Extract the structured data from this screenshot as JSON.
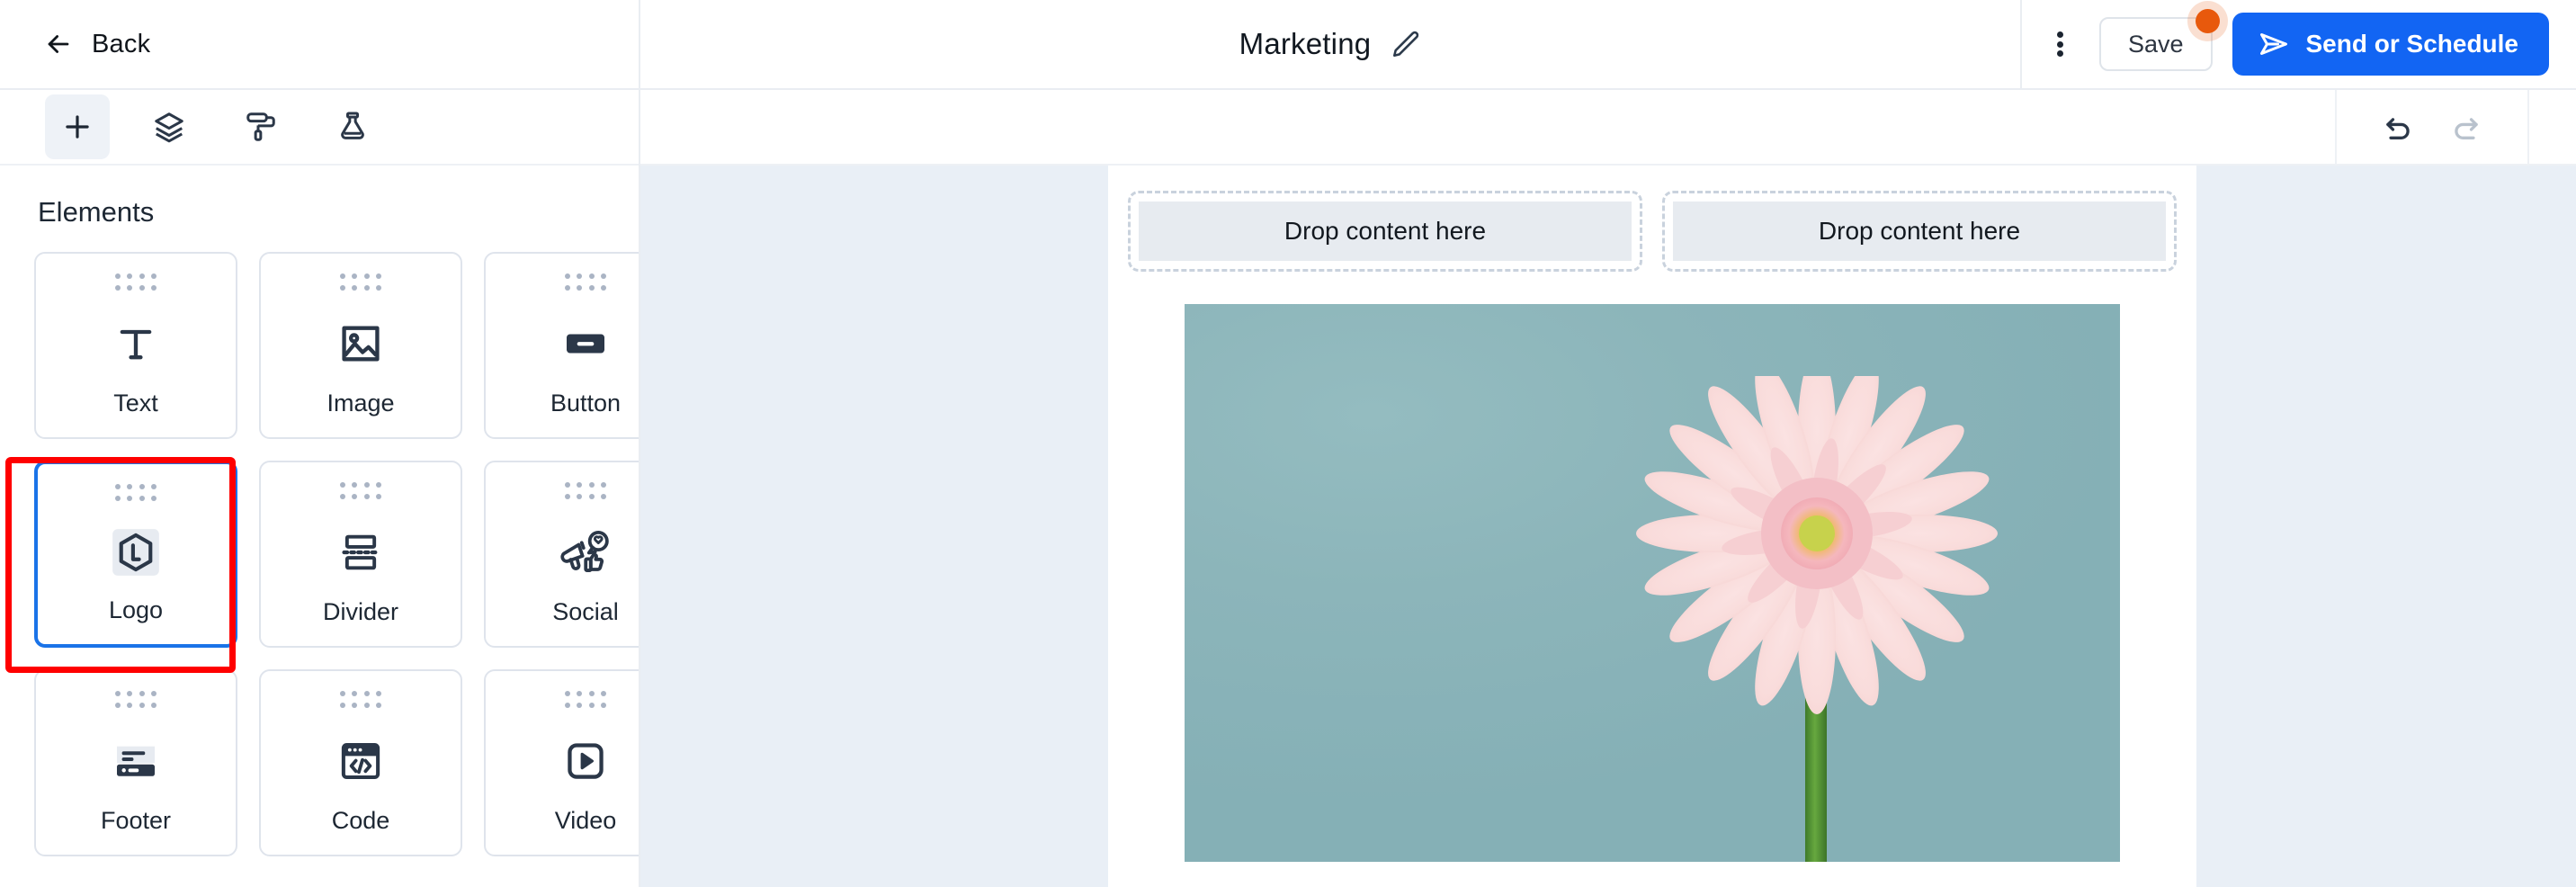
{
  "header": {
    "back_label": "Back",
    "back_icon": "arrow-left-icon",
    "doc_title": "Marketing",
    "edit_icon": "pencil-edit-icon",
    "kebab_icon": "more-vertical-icon",
    "save_label": "Save",
    "save_badge": "unsaved-changes-dot",
    "send_label": "Send or Schedule",
    "send_icon": "paper-plane-icon",
    "accent_blue": "#1265f3",
    "badge_orange": "#e8590c"
  },
  "sidebar": {
    "tools": [
      {
        "name": "add-content-tool",
        "icon": "plus-icon",
        "active": true
      },
      {
        "name": "layers-tool",
        "icon": "layers-icon",
        "active": false
      },
      {
        "name": "styles-tool",
        "icon": "paint-roller-icon",
        "active": false
      },
      {
        "name": "experiments-tool",
        "icon": "flask-icon",
        "active": false
      }
    ],
    "panel_title": "Elements",
    "elements": [
      {
        "label": "Text",
        "icon": "text-t-icon"
      },
      {
        "label": "Image",
        "icon": "image-icon"
      },
      {
        "label": "Button",
        "icon": "button-icon"
      },
      {
        "label": "Logo",
        "icon": "logo-hexagon-icon",
        "selected": true
      },
      {
        "label": "Divider",
        "icon": "divider-icon"
      },
      {
        "label": "Social",
        "icon": "social-megaphone-icon"
      },
      {
        "label": "Footer",
        "icon": "footer-icon"
      },
      {
        "label": "Code",
        "icon": "code-window-icon"
      },
      {
        "label": "Video",
        "icon": "video-play-icon"
      }
    ],
    "highlight_color": "#ff0000",
    "selection_color": "#1a73e8"
  },
  "canvas": {
    "undo_icon": "undo-arrow-icon",
    "redo_icon": "redo-arrow-icon",
    "undo_enabled": true,
    "redo_enabled": false,
    "dropzones": [
      {
        "label": "Drop content here"
      },
      {
        "label": "Drop content here"
      }
    ],
    "hero": {
      "name": "pink-gerbera-daisy-photo",
      "background_color": "#8cb5ba",
      "petal_color": "#f6d6d6",
      "center_color": "#c9d44b",
      "stem_color": "#4e8b33"
    },
    "background_color": "#e9eff6"
  }
}
